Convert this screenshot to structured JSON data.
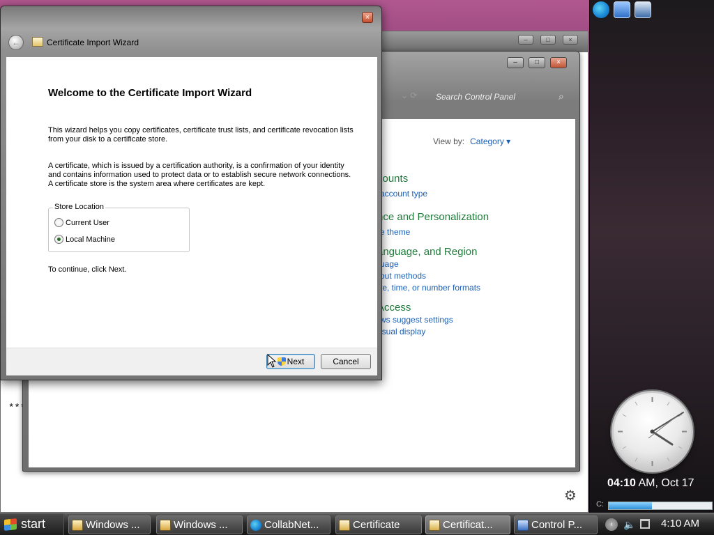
{
  "wizard": {
    "title": "Certificate Import Wizard",
    "close_label": "×",
    "heading": "Welcome to the Certificate Import Wizard",
    "paragraph1": "This wizard helps you copy certificates, certificate trust lists, and certificate revocation lists from your disk to a certificate store.",
    "paragraph2": "A certificate, which is issued by a certification authority, is a confirmation of your identity and contains information used to protect data or to establish secure network connections. A certificate store is the system area where certificates are kept.",
    "store_location": {
      "legend": "Store Location",
      "options": [
        {
          "label": "Current User",
          "selected": false
        },
        {
          "label": "Local Machine",
          "selected": true
        }
      ]
    },
    "continue_text": "To continue, click Next.",
    "next_label": "Next",
    "cancel_label": "Cancel"
  },
  "control_panel": {
    "search_placeholder": "Search Control Panel",
    "view_by_label": "View by:",
    "view_by_value": "Category",
    "categories": [
      {
        "title": "counts",
        "links": [
          "account type"
        ]
      },
      {
        "title": "nce and Personalization",
        "links": [
          "e theme"
        ]
      },
      {
        "title": "anguage, and Region",
        "links": [
          "uage",
          "out methods",
          "te, time, or number formats"
        ]
      },
      {
        "title": "Access",
        "links": [
          "ws suggest settings",
          "isual display"
        ]
      }
    ]
  },
  "background_window": {
    "asterisks": "***"
  },
  "sidebar": {
    "clock": {
      "time": "04:10",
      "suffix": " AM, Oct 17"
    },
    "drive": {
      "label": "C:",
      "fill_fraction": 0.42
    }
  },
  "taskbar": {
    "start_label": "start",
    "tasks": [
      {
        "label": "Windows ...",
        "icon": "window-icon"
      },
      {
        "label": "Windows ...",
        "icon": "window-icon"
      },
      {
        "label": "CollabNet...",
        "icon": "edge-icon"
      },
      {
        "label": "Certificate",
        "icon": "certificate-icon"
      },
      {
        "label": "Certificat...",
        "icon": "certificate-icon"
      },
      {
        "label": "Control P...",
        "icon": "control-panel-icon"
      }
    ],
    "time": "4:10 AM"
  },
  "colors": {
    "link_blue": "#1a5fb4",
    "category_green": "#1e7b3a"
  }
}
